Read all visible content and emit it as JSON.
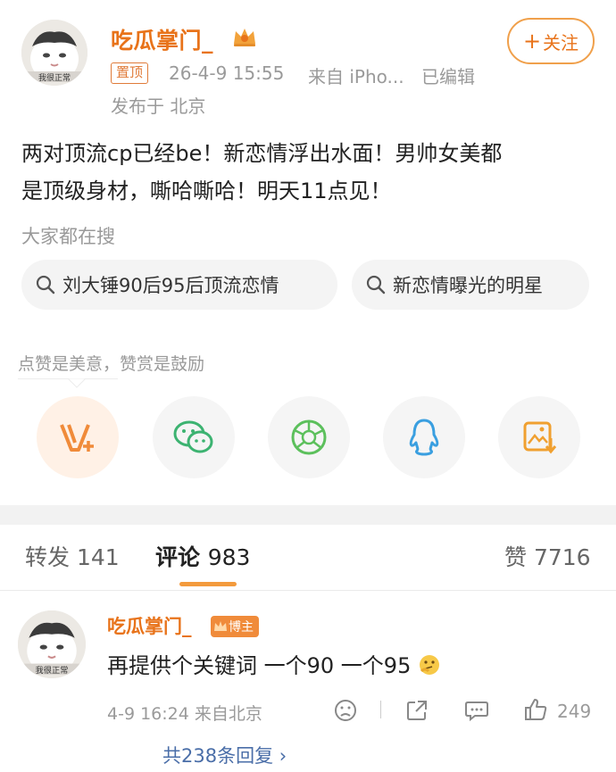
{
  "post": {
    "author": "吃瓜掌门_",
    "follow_label": "关注",
    "pin_label": "置顶",
    "timestamp": "26-4-9 15:55",
    "source": "来自 iPho...",
    "edited": "已编辑",
    "location": "发布于 北京",
    "content_line1": "两对顶流cp已经be！新恋情浮出水面！男帅女美都",
    "content_line2": "是顶级身材，嘶哈嘶哈！明天11点见！",
    "search_title": "大家都在搜",
    "search_pills": [
      "刘大锤90后95后顶流恋情",
      "新恋情曝光的明星"
    ],
    "reward_tip": "点赞是美意，赞赏是鼓励"
  },
  "share_icons": [
    "reward-v-icon",
    "wechat-icon",
    "moments-icon",
    "qq-icon",
    "save-image-icon"
  ],
  "tabs": {
    "repost_label": "转发",
    "repost_count": "141",
    "comment_label": "评论",
    "comment_count": "983",
    "like_label": "赞",
    "like_count": "7716"
  },
  "comment": {
    "author": "吃瓜掌门_",
    "badge": "博主",
    "text": "再提供个关键词 一个90 一个95",
    "emoji": "thinking-emoji",
    "meta": "4-9 16:24 来自北京",
    "likes": "249",
    "replies": "共238条回复"
  },
  "colors": {
    "accent": "#e8731a",
    "link": "#4a6ea8",
    "wechat": "#3cb371",
    "qq": "#3a9fe0",
    "moments": "#5cc05c"
  }
}
